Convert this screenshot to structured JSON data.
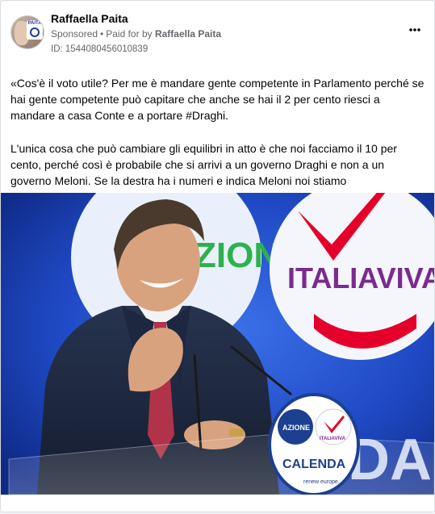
{
  "post": {
    "author": "Raffaella Paita",
    "sponsored_label": "Sponsored",
    "paid_for_label": "Paid for by",
    "paid_for_name": "Raffaella Paita",
    "ad_id": "ID: 1544080456010839",
    "more_icon": "more-horizontal-icon",
    "avatar_badge_text": "PAITA",
    "paragraphs": [
      "«Cos'è il voto utile? Per me è mandare gente competente in Parlamento perché se hai gente competente può capitare che anche se hai il 2 per cento riesci a mandare a casa Conte e a portare #Draghi.",
      "L'unica cosa che può cambiare gli equilibri in atto è che noi facciamo il 10 per cento, perché così è probabile che si arrivi a un governo Draghi e non a un governo Meloni. Se la destra ha i numeri e indica Meloni noi stiamo all'opposizione:..."
    ]
  },
  "image": {
    "backdrop_logo_left_text": "ZIONE",
    "backdrop_logo_right_text": "ITALIAVIVA",
    "backdrop_bottom_text": "DA",
    "podium_logo_left": "AZIONE",
    "podium_logo_right": "ITALIAVIVA",
    "podium_name": "CALENDA",
    "podium_tagline": "renew europe.",
    "colors": {
      "backdrop_blue": "#1b3fb0",
      "azione_green": "#2bb24c",
      "italiaviva_red": "#e4002b",
      "italiaviva_purple": "#7b2a8f",
      "podium_navy": "#1d3f8f"
    }
  }
}
